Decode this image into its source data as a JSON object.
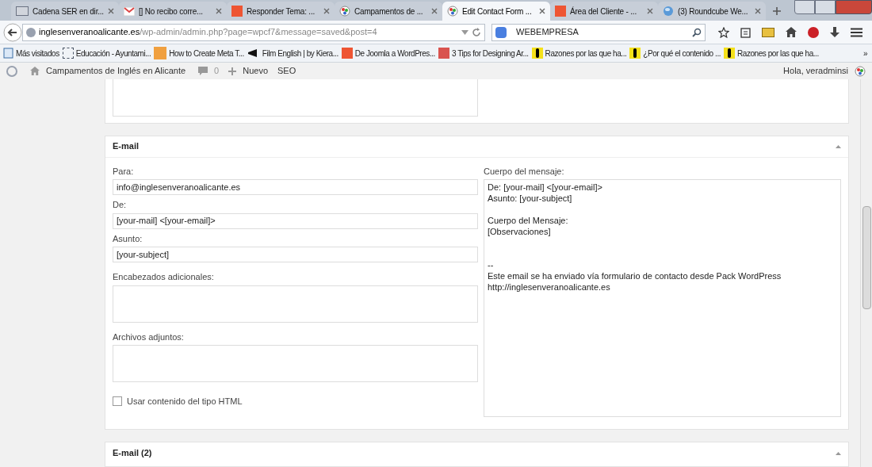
{
  "browser": {
    "tabs": [
      {
        "title": "Cadena SER en dir...",
        "selected": false
      },
      {
        "title": "[] No recibo corre...",
        "selected": false
      },
      {
        "title": "Responder Tema: ...",
        "selected": false
      },
      {
        "title": "Campamentos de ...",
        "selected": false
      },
      {
        "title": "Edit Contact Form ...",
        "selected": true
      },
      {
        "title": "Área del Cliente - ...",
        "selected": false
      },
      {
        "title": "(3) Roundcube We...",
        "selected": false
      }
    ],
    "url_host": "inglesenveranoalicante.es",
    "url_path": "/wp-admin/admin.php?page=wpcf7&message=saved&post=4",
    "search_value": "WEBEMPRESA",
    "bookmarks": [
      {
        "title": "Más visitados"
      },
      {
        "title": "Educación - Ayuntami..."
      },
      {
        "title": "How to Create Meta T..."
      },
      {
        "title": "Film English | by Kiera..."
      },
      {
        "title": "De Joomla a WordPres..."
      },
      {
        "title": "3 Tips for Designing Ar..."
      },
      {
        "title": "Razones por las que ha..."
      },
      {
        "title": "¿Por qué el contenido ..."
      },
      {
        "title": "Razones por las que ha..."
      }
    ],
    "bookmarks_more": "»"
  },
  "admin_bar": {
    "site": "Campamentos de Inglés en Alicante",
    "comments": "0",
    "new": "Nuevo",
    "seo": "SEO",
    "greeting": "Hola, veradminsi"
  },
  "email_panel": {
    "title": "E-mail",
    "fields": [
      {
        "label": "Para:",
        "value": "info@inglesenveranoalicante.es"
      },
      {
        "label": "De:",
        "value": "[your-mail] <[your-email]>"
      },
      {
        "label": "Asunto:",
        "value": "[your-subject]"
      }
    ],
    "textareas": [
      {
        "label": "Encabezados adicionales:"
      },
      {
        "label": "Archivos adjuntos:"
      }
    ],
    "html_checkbox": {
      "label": "Usar contenido del tipo HTML",
      "checked": false
    },
    "body_label": "Cuerpo del mensaje:",
    "body": "De: [your-mail] <[your-email]>\nAsunto: [your-subject]\n\nCuerpo del Mensaje:\n[Observaciones]\n\n\n--\nEste email se ha enviado vía formulario de contacto desde Pack WordPress\nhttp://inglesenveranoalicante.es"
  },
  "email2_panel": {
    "title": "E-mail (2)"
  }
}
